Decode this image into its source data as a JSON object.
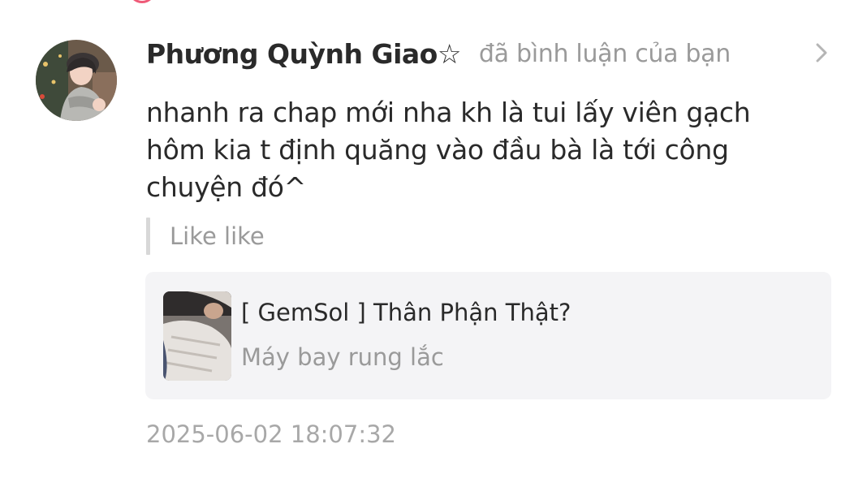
{
  "notification": {
    "username": "Phương Quỳnh Giao☆",
    "action": "đã bình luận của bạn",
    "comment_lines": [
      "nhanh ra chap mới nha kh là tui lấy viên gạch",
      "hôm kia t định quăng vào đầu bà là tới công",
      "chuyện đó^"
    ],
    "quoted_reply": "Like like",
    "timestamp": "2025-06-02 18:07:32"
  },
  "linked_post": {
    "title": "[ GemSol ] Thân Phận Thật?",
    "subtitle": "Máy bay rung lắc"
  },
  "icons": {
    "chevron": "chevron-right-icon"
  },
  "colors": {
    "text_primary": "#2a2a2a",
    "text_secondary": "#9a9a9a",
    "card_background": "#f4f4f6",
    "accent": "#ef5a78"
  }
}
